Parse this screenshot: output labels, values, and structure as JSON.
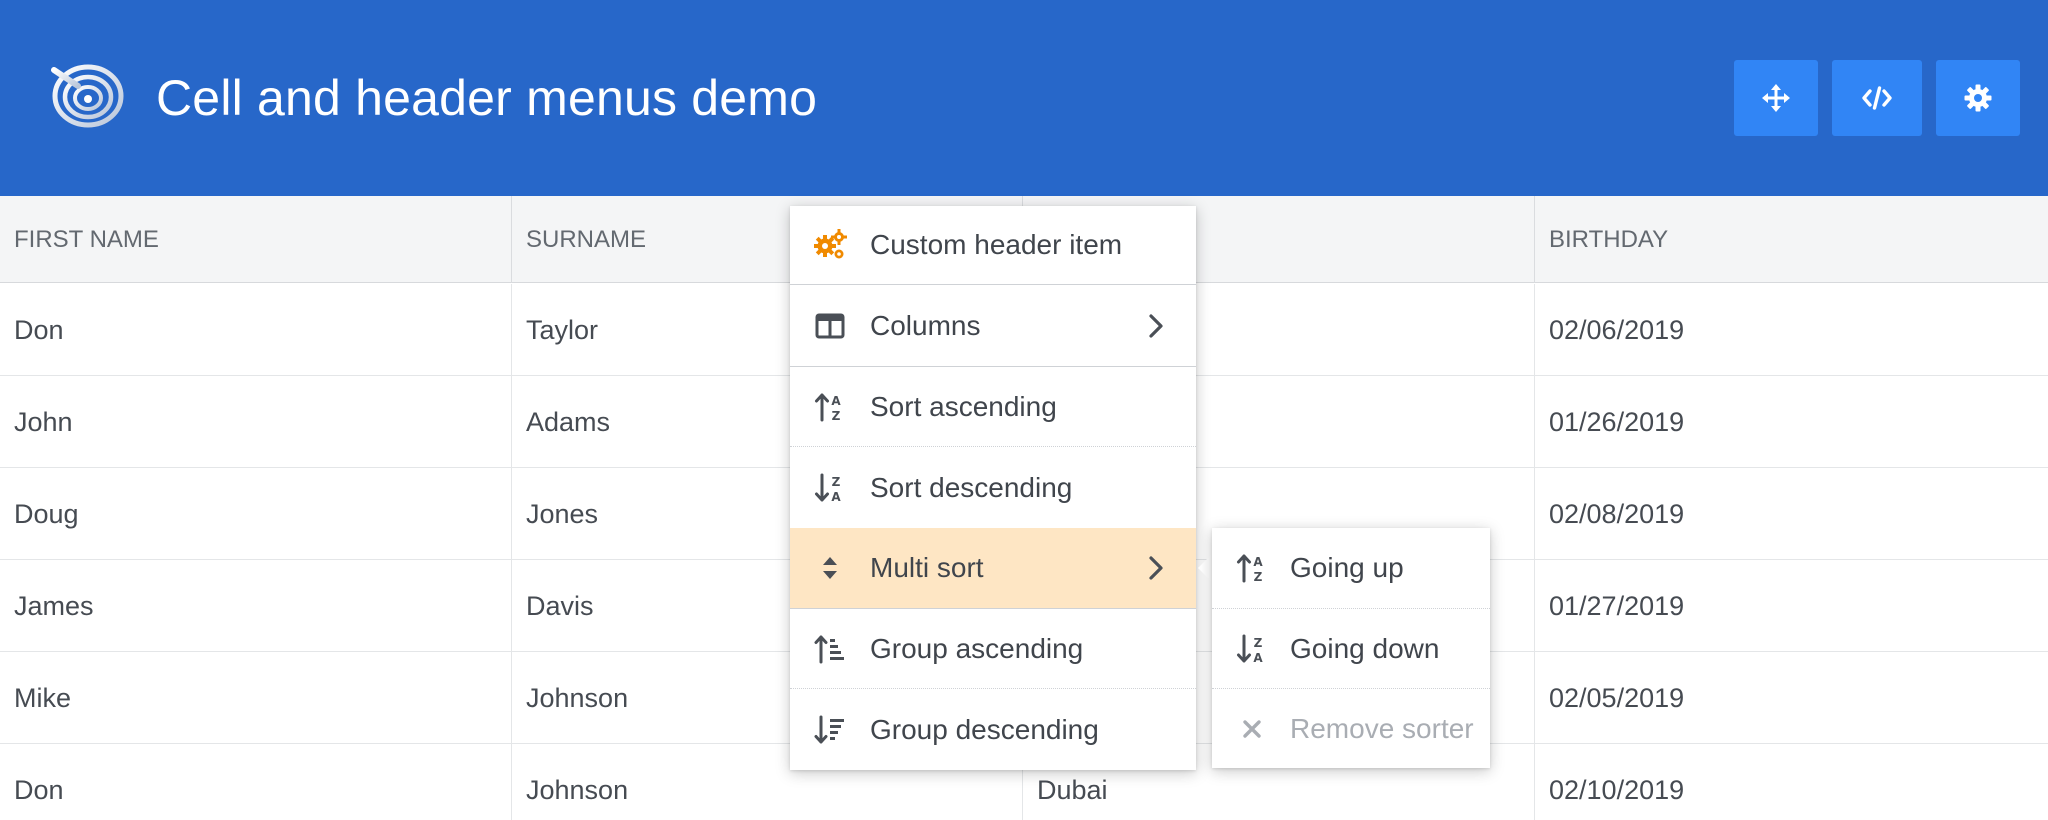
{
  "header": {
    "title": "Cell and header menus demo",
    "background": "#2767c9",
    "button_color": "#3185f5",
    "buttons": [
      {
        "icon": "move-arrows-icon"
      },
      {
        "icon": "code-icon"
      },
      {
        "icon": "gear-icon"
      }
    ]
  },
  "grid": {
    "columns": [
      "First name",
      "Surname",
      "",
      "Birthday"
    ],
    "rows": [
      [
        "Don",
        "Taylor",
        "",
        "02/06/2019"
      ],
      [
        "John",
        "Adams",
        "",
        "01/26/2019"
      ],
      [
        "Doug",
        "Jones",
        "",
        "02/08/2019"
      ],
      [
        "James",
        "Davis",
        "",
        "01/27/2019"
      ],
      [
        "Mike",
        "Johnson",
        "",
        "02/05/2019"
      ],
      [
        "Don",
        "Johnson",
        "Dubai",
        "02/10/2019"
      ]
    ]
  },
  "header_menu": {
    "items": [
      {
        "label": "Custom header item",
        "icon": "gears-icon",
        "icon_color": "#f08a00"
      },
      {
        "label": "Columns",
        "icon": "columns-icon",
        "has_submenu": true
      },
      {
        "label": "Sort ascending",
        "icon": "sort-asc-icon"
      },
      {
        "label": "Sort descending",
        "icon": "sort-desc-icon"
      },
      {
        "label": "Multi sort",
        "icon": "multi-sort-icon",
        "has_submenu": true,
        "highlighted": true
      },
      {
        "label": "Group ascending",
        "icon": "group-asc-icon"
      },
      {
        "label": "Group descending",
        "icon": "group-desc-icon"
      }
    ],
    "highlight_color": "#fee6c4"
  },
  "multi_sort_submenu": {
    "items": [
      {
        "label": "Going up",
        "icon": "sort-asc-icon"
      },
      {
        "label": "Going down",
        "icon": "sort-desc-icon"
      },
      {
        "label": "Remove sorter",
        "icon": "close-icon",
        "disabled": true
      }
    ]
  }
}
